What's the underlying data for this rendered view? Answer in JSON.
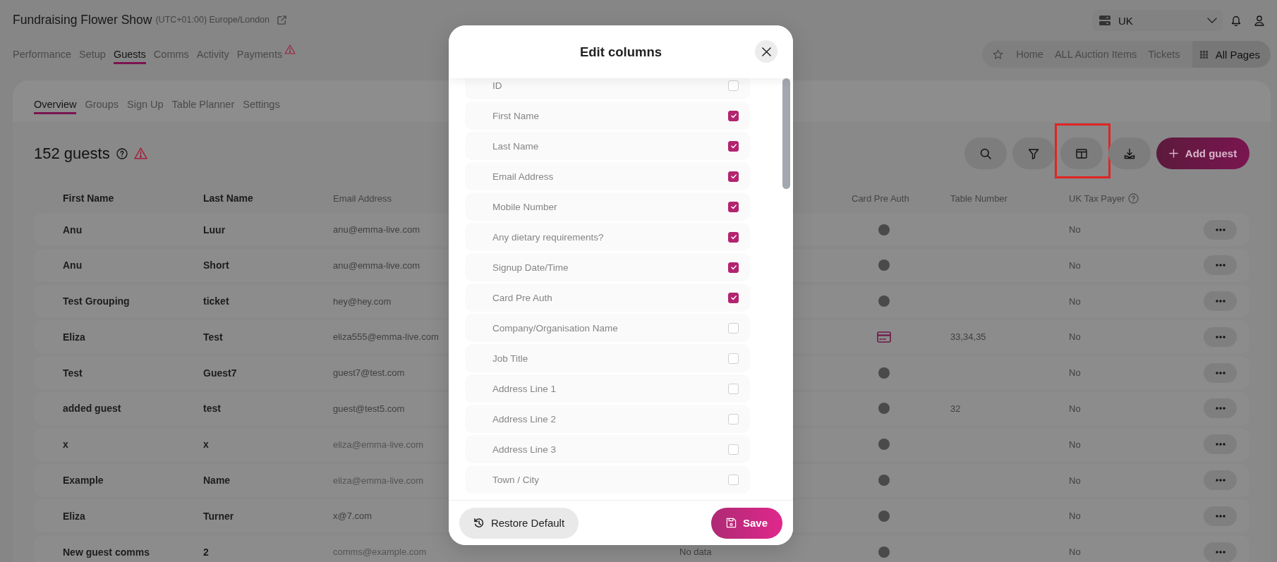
{
  "event": {
    "title": "Fundraising Flower Show",
    "timezone": "(UTC+01:00) Europe/London"
  },
  "nav_tabs": [
    {
      "label": "Performance",
      "selected": false,
      "warning": false
    },
    {
      "label": "Setup",
      "selected": false,
      "warning": false
    },
    {
      "label": "Guests",
      "selected": true,
      "warning": false
    },
    {
      "label": "Comms",
      "selected": false,
      "warning": false
    },
    {
      "label": "Activity",
      "selected": false,
      "warning": false
    },
    {
      "label": "Payments",
      "selected": false,
      "warning": true
    }
  ],
  "region_select": {
    "value": "UK"
  },
  "quick_links": {
    "items": [
      "Home",
      "ALL Auction Items",
      "Tickets"
    ],
    "all_pages": "All Pages"
  },
  "sub_tabs": [
    {
      "label": "Overview",
      "selected": true
    },
    {
      "label": "Groups",
      "selected": false
    },
    {
      "label": "Sign Up",
      "selected": false
    },
    {
      "label": "Table Planner",
      "selected": false
    },
    {
      "label": "Settings",
      "selected": false
    }
  ],
  "guest_count": {
    "label": "152 guests",
    "warning": true
  },
  "toolbar": {
    "buttons": [
      {
        "kind": "search",
        "highlighted": false
      },
      {
        "kind": "filter",
        "highlighted": false
      },
      {
        "kind": "columns",
        "highlighted": true
      },
      {
        "kind": "download",
        "highlighted": false
      }
    ],
    "add_button": "Add guest"
  },
  "table": {
    "columns": {
      "first_name": "First Name",
      "last_name": "Last Name",
      "email": "Email Address",
      "card_pre_auth": "Card Pre Auth",
      "table_number": "Table Number",
      "uk_tax_payer": "UK Tax Payer"
    },
    "rows": [
      {
        "first_name": "Anu",
        "last_name": "Luur",
        "email": "anu@emma-live.com",
        "email_dimmed": false,
        "card_pre_auth": {
          "kind": "dot"
        },
        "uk_tax_payer": "No"
      },
      {
        "first_name": "Anu",
        "last_name": "Short",
        "email": "anu@emma-live.com",
        "email_dimmed": false,
        "card_pre_auth": {
          "kind": "dot"
        },
        "uk_tax_payer": "No"
      },
      {
        "first_name": "Test Grouping",
        "last_name": "ticket",
        "email": "hey@hey.com",
        "email_dimmed": false,
        "card_pre_auth": {
          "kind": "dot"
        },
        "uk_tax_payer": "No"
      },
      {
        "first_name": "Eliza",
        "last_name": "Test",
        "email": "eliza555@emma-live.com",
        "email_dimmed": false,
        "card_pre_auth": {
          "kind": "card"
        },
        "table_number": "33,34,35",
        "uk_tax_payer": "No"
      },
      {
        "first_name": "Test",
        "last_name": "Guest7",
        "email": "guest7@test.com",
        "email_dimmed": false,
        "card_pre_auth": {
          "kind": "dot"
        },
        "uk_tax_payer": "No"
      },
      {
        "first_name": "added guest",
        "last_name": "test",
        "email": "guest@test5.com",
        "email_dimmed": false,
        "card_pre_auth": {
          "kind": "dot"
        },
        "table_number": "32",
        "uk_tax_payer": "No"
      },
      {
        "first_name": "x",
        "last_name": "x",
        "email": "eliza@emma-live.com",
        "email_dimmed": true,
        "card_pre_auth": {
          "kind": "dot"
        },
        "uk_tax_payer": "No"
      },
      {
        "first_name": "Example",
        "last_name": "Name",
        "email": "eliza@emma-live.com",
        "email_dimmed": true,
        "card_pre_auth": {
          "kind": "dot"
        },
        "uk_tax_payer": "No"
      },
      {
        "first_name": "Eliza",
        "last_name": "Turner",
        "email": "x@7.com",
        "email_dimmed": false,
        "card_pre_auth": {
          "kind": "dot"
        },
        "uk_tax_payer": "No"
      },
      {
        "first_name": "New guest comms",
        "last_name": "2",
        "email": "comms@example.com",
        "email_dimmed": true,
        "column_4": "No data",
        "card_pre_auth": {
          "kind": "dot"
        },
        "uk_tax_payer": "No"
      }
    ]
  },
  "edit_columns": {
    "title": "Edit columns",
    "columns": [
      {
        "label": "ID",
        "checked": false
      },
      {
        "label": "First Name",
        "checked": true
      },
      {
        "label": "Last Name",
        "checked": true
      },
      {
        "label": "Email Address",
        "checked": true
      },
      {
        "label": "Mobile Number",
        "checked": true
      },
      {
        "label": "Any dietary requirements?",
        "checked": true
      },
      {
        "label": "Signup Date/Time",
        "checked": true
      },
      {
        "label": "Card Pre Auth",
        "checked": true
      },
      {
        "label": "Company/Organisation Name",
        "checked": false
      },
      {
        "label": "Job Title",
        "checked": false
      },
      {
        "label": "Address Line 1",
        "checked": false
      },
      {
        "label": "Address Line 2",
        "checked": false
      },
      {
        "label": "Address Line 3",
        "checked": false
      },
      {
        "label": "Town / City",
        "checked": false
      }
    ],
    "restore_button": "Restore Default",
    "save_button": "Save"
  }
}
